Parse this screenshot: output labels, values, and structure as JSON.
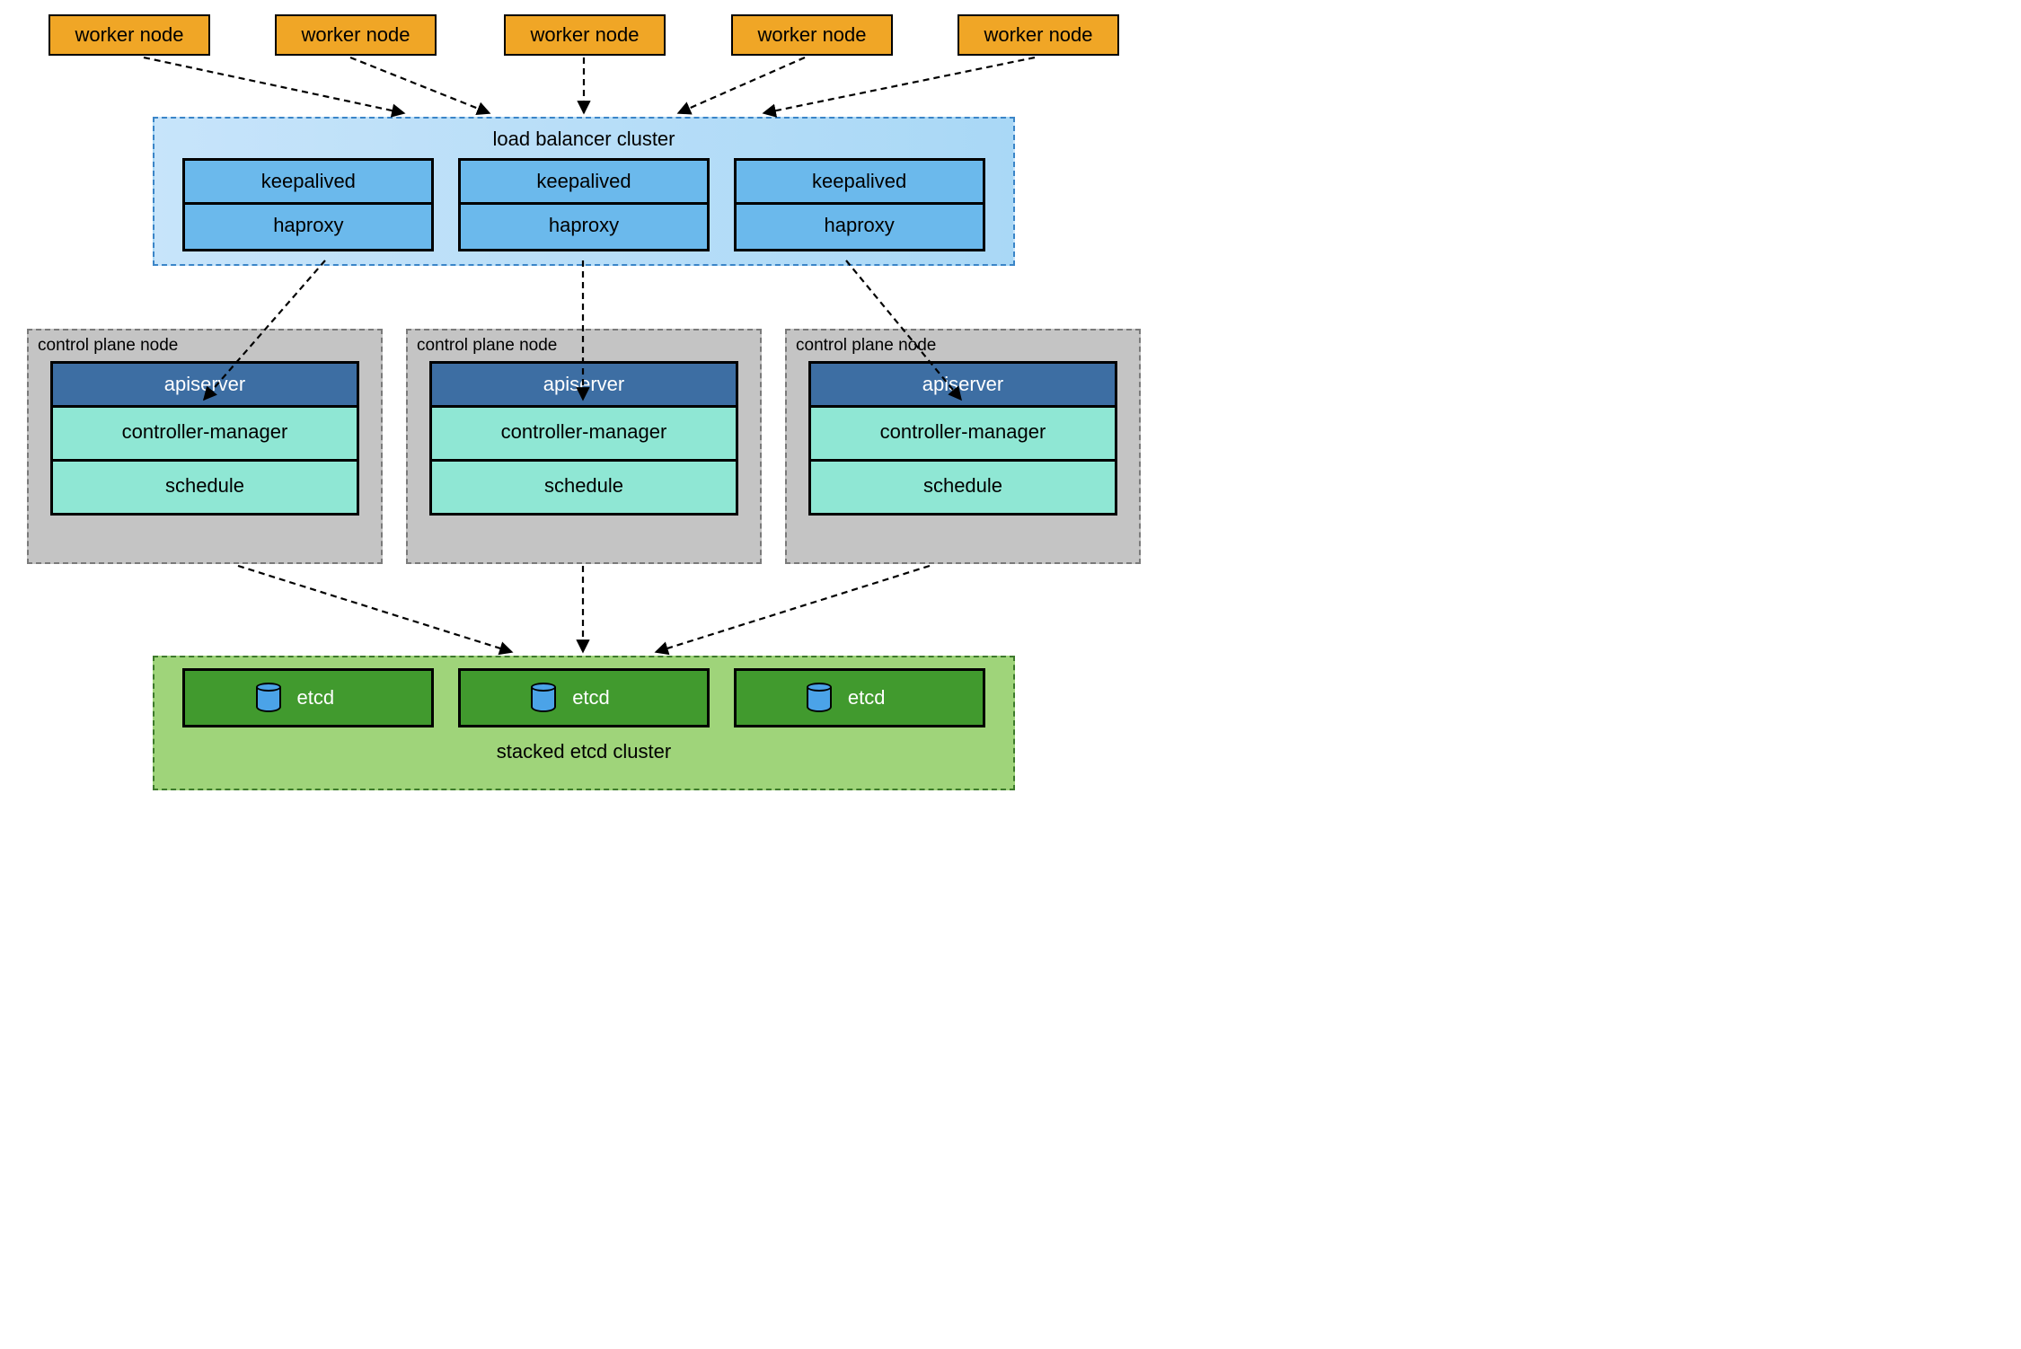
{
  "workers": [
    {
      "label": "worker node"
    },
    {
      "label": "worker node"
    },
    {
      "label": "worker node"
    },
    {
      "label": "worker node"
    },
    {
      "label": "worker node"
    }
  ],
  "lb": {
    "title": "load balancer cluster",
    "nodes": [
      {
        "keepalived": "keepalived",
        "haproxy": "haproxy"
      },
      {
        "keepalived": "keepalived",
        "haproxy": "haproxy"
      },
      {
        "keepalived": "keepalived",
        "haproxy": "haproxy"
      }
    ]
  },
  "control_plane": {
    "title": "control plane node",
    "nodes": [
      {
        "apiserver": "apiserver",
        "controller_manager": "controller-manager",
        "schedule": "schedule"
      },
      {
        "apiserver": "apiserver",
        "controller_manager": "controller-manager",
        "schedule": "schedule"
      },
      {
        "apiserver": "apiserver",
        "controller_manager": "controller-manager",
        "schedule": "schedule"
      }
    ]
  },
  "etcd": {
    "title": "stacked etcd cluster",
    "nodes": [
      {
        "label": "etcd"
      },
      {
        "label": "etcd"
      },
      {
        "label": "etcd"
      }
    ]
  }
}
